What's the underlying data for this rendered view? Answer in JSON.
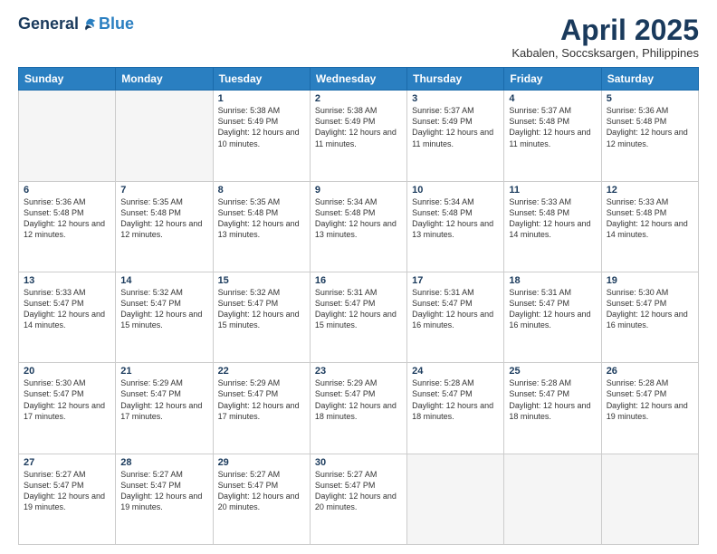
{
  "logo": {
    "general": "General",
    "blue": "Blue"
  },
  "title": {
    "month_year": "April 2025",
    "location": "Kabalen, Soccsksargen, Philippines"
  },
  "weekdays": [
    "Sunday",
    "Monday",
    "Tuesday",
    "Wednesday",
    "Thursday",
    "Friday",
    "Saturday"
  ],
  "weeks": [
    [
      {
        "day": "",
        "empty": true
      },
      {
        "day": "",
        "empty": true
      },
      {
        "day": "1",
        "sunrise": "Sunrise: 5:38 AM",
        "sunset": "Sunset: 5:49 PM",
        "daylight": "Daylight: 12 hours and 10 minutes."
      },
      {
        "day": "2",
        "sunrise": "Sunrise: 5:38 AM",
        "sunset": "Sunset: 5:49 PM",
        "daylight": "Daylight: 12 hours and 11 minutes."
      },
      {
        "day": "3",
        "sunrise": "Sunrise: 5:37 AM",
        "sunset": "Sunset: 5:49 PM",
        "daylight": "Daylight: 12 hours and 11 minutes."
      },
      {
        "day": "4",
        "sunrise": "Sunrise: 5:37 AM",
        "sunset": "Sunset: 5:48 PM",
        "daylight": "Daylight: 12 hours and 11 minutes."
      },
      {
        "day": "5",
        "sunrise": "Sunrise: 5:36 AM",
        "sunset": "Sunset: 5:48 PM",
        "daylight": "Daylight: 12 hours and 12 minutes."
      }
    ],
    [
      {
        "day": "6",
        "sunrise": "Sunrise: 5:36 AM",
        "sunset": "Sunset: 5:48 PM",
        "daylight": "Daylight: 12 hours and 12 minutes."
      },
      {
        "day": "7",
        "sunrise": "Sunrise: 5:35 AM",
        "sunset": "Sunset: 5:48 PM",
        "daylight": "Daylight: 12 hours and 12 minutes."
      },
      {
        "day": "8",
        "sunrise": "Sunrise: 5:35 AM",
        "sunset": "Sunset: 5:48 PM",
        "daylight": "Daylight: 12 hours and 13 minutes."
      },
      {
        "day": "9",
        "sunrise": "Sunrise: 5:34 AM",
        "sunset": "Sunset: 5:48 PM",
        "daylight": "Daylight: 12 hours and 13 minutes."
      },
      {
        "day": "10",
        "sunrise": "Sunrise: 5:34 AM",
        "sunset": "Sunset: 5:48 PM",
        "daylight": "Daylight: 12 hours and 13 minutes."
      },
      {
        "day": "11",
        "sunrise": "Sunrise: 5:33 AM",
        "sunset": "Sunset: 5:48 PM",
        "daylight": "Daylight: 12 hours and 14 minutes."
      },
      {
        "day": "12",
        "sunrise": "Sunrise: 5:33 AM",
        "sunset": "Sunset: 5:48 PM",
        "daylight": "Daylight: 12 hours and 14 minutes."
      }
    ],
    [
      {
        "day": "13",
        "sunrise": "Sunrise: 5:33 AM",
        "sunset": "Sunset: 5:47 PM",
        "daylight": "Daylight: 12 hours and 14 minutes."
      },
      {
        "day": "14",
        "sunrise": "Sunrise: 5:32 AM",
        "sunset": "Sunset: 5:47 PM",
        "daylight": "Daylight: 12 hours and 15 minutes."
      },
      {
        "day": "15",
        "sunrise": "Sunrise: 5:32 AM",
        "sunset": "Sunset: 5:47 PM",
        "daylight": "Daylight: 12 hours and 15 minutes."
      },
      {
        "day": "16",
        "sunrise": "Sunrise: 5:31 AM",
        "sunset": "Sunset: 5:47 PM",
        "daylight": "Daylight: 12 hours and 15 minutes."
      },
      {
        "day": "17",
        "sunrise": "Sunrise: 5:31 AM",
        "sunset": "Sunset: 5:47 PM",
        "daylight": "Daylight: 12 hours and 16 minutes."
      },
      {
        "day": "18",
        "sunrise": "Sunrise: 5:31 AM",
        "sunset": "Sunset: 5:47 PM",
        "daylight": "Daylight: 12 hours and 16 minutes."
      },
      {
        "day": "19",
        "sunrise": "Sunrise: 5:30 AM",
        "sunset": "Sunset: 5:47 PM",
        "daylight": "Daylight: 12 hours and 16 minutes."
      }
    ],
    [
      {
        "day": "20",
        "sunrise": "Sunrise: 5:30 AM",
        "sunset": "Sunset: 5:47 PM",
        "daylight": "Daylight: 12 hours and 17 minutes."
      },
      {
        "day": "21",
        "sunrise": "Sunrise: 5:29 AM",
        "sunset": "Sunset: 5:47 PM",
        "daylight": "Daylight: 12 hours and 17 minutes."
      },
      {
        "day": "22",
        "sunrise": "Sunrise: 5:29 AM",
        "sunset": "Sunset: 5:47 PM",
        "daylight": "Daylight: 12 hours and 17 minutes."
      },
      {
        "day": "23",
        "sunrise": "Sunrise: 5:29 AM",
        "sunset": "Sunset: 5:47 PM",
        "daylight": "Daylight: 12 hours and 18 minutes."
      },
      {
        "day": "24",
        "sunrise": "Sunrise: 5:28 AM",
        "sunset": "Sunset: 5:47 PM",
        "daylight": "Daylight: 12 hours and 18 minutes."
      },
      {
        "day": "25",
        "sunrise": "Sunrise: 5:28 AM",
        "sunset": "Sunset: 5:47 PM",
        "daylight": "Daylight: 12 hours and 18 minutes."
      },
      {
        "day": "26",
        "sunrise": "Sunrise: 5:28 AM",
        "sunset": "Sunset: 5:47 PM",
        "daylight": "Daylight: 12 hours and 19 minutes."
      }
    ],
    [
      {
        "day": "27",
        "sunrise": "Sunrise: 5:27 AM",
        "sunset": "Sunset: 5:47 PM",
        "daylight": "Daylight: 12 hours and 19 minutes."
      },
      {
        "day": "28",
        "sunrise": "Sunrise: 5:27 AM",
        "sunset": "Sunset: 5:47 PM",
        "daylight": "Daylight: 12 hours and 19 minutes."
      },
      {
        "day": "29",
        "sunrise": "Sunrise: 5:27 AM",
        "sunset": "Sunset: 5:47 PM",
        "daylight": "Daylight: 12 hours and 20 minutes."
      },
      {
        "day": "30",
        "sunrise": "Sunrise: 5:27 AM",
        "sunset": "Sunset: 5:47 PM",
        "daylight": "Daylight: 12 hours and 20 minutes."
      },
      {
        "day": "",
        "empty": true
      },
      {
        "day": "",
        "empty": true
      },
      {
        "day": "",
        "empty": true
      }
    ]
  ]
}
